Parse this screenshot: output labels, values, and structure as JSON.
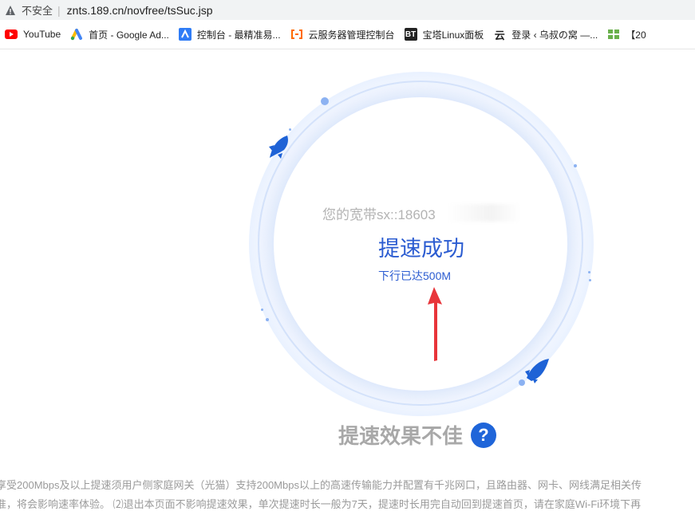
{
  "browser": {
    "security_label": "不安全",
    "url": "znts.189.cn/novfree/tsSuc.jsp"
  },
  "bookmarks": [
    {
      "label": "YouTube",
      "icon": "youtube-icon"
    },
    {
      "label": "首页 - Google Ad...",
      "icon": "google-ads-icon"
    },
    {
      "label": "控制台 - 最精准易...",
      "icon": "console-icon"
    },
    {
      "label": "云服务器管理控制台",
      "icon": "aliyun-icon"
    },
    {
      "label": "宝塔Linux面板",
      "icon": "bt-icon",
      "icon_text": "BT"
    },
    {
      "label": "登录 ‹ 乌叔の窝 —...",
      "icon": "yun-icon",
      "icon_text": "云"
    },
    {
      "label": "【20",
      "icon": "green-grid-icon"
    }
  ],
  "result": {
    "broadband_label": "您的宽带sx::18603",
    "title": "提速成功",
    "subtitle": "下行已达500M"
  },
  "help": {
    "label": "提速效果不佳",
    "icon_text": "?"
  },
  "notes": {
    "line1": "享受200Mbps及以上提速须用户侧家庭网关（光猫）支持200Mbps以上的高速传输能力并配置有千兆网口，且路由器、网卡、网线满足相关传",
    "line2": "准，将会影响速率体验。 ⑵退出本页面不影响提速效果，单次提速时长一般为7天，提速时长用完自动回到提速首页，请在家庭Wi-Fi环境下再"
  },
  "colors": {
    "accent": "#2b5cd1",
    "help_icon": "#1f65d9",
    "arrow": "#e8353a"
  }
}
